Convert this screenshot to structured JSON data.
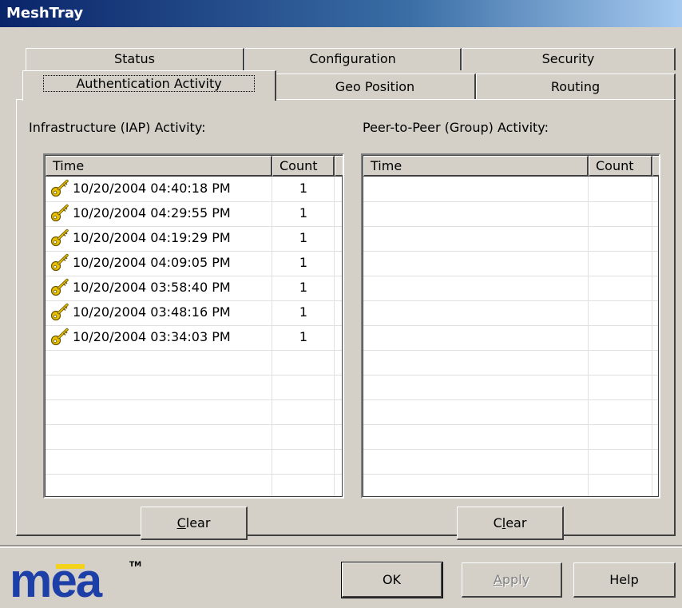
{
  "window": {
    "title": "MeshTray"
  },
  "tabs": {
    "row1": [
      "Status",
      "Configuration",
      "Security"
    ],
    "row2": [
      "Authentication Activity",
      "Geo Position",
      "Routing"
    ]
  },
  "iap": {
    "label": "Infrastructure (IAP) Activity:",
    "columns": [
      "Time",
      "Count"
    ],
    "rows": [
      {
        "time": "10/20/2004 04:40:18 PM",
        "count": "1",
        "icon": "key-icon"
      },
      {
        "time": "10/20/2004 04:29:55 PM",
        "count": "1",
        "icon": "key-icon"
      },
      {
        "time": "10/20/2004 04:19:29 PM",
        "count": "1",
        "icon": "key-icon"
      },
      {
        "time": "10/20/2004 04:09:05 PM",
        "count": "1",
        "icon": "key-icon"
      },
      {
        "time": "10/20/2004 03:58:40 PM",
        "count": "1",
        "icon": "key-icon"
      },
      {
        "time": "10/20/2004 03:48:16 PM",
        "count": "1",
        "icon": "key-icon"
      },
      {
        "time": "10/20/2004 03:34:03 PM",
        "count": "1",
        "icon": "key-icon"
      }
    ],
    "clear": {
      "mnemonic": "C",
      "rest": "lear"
    }
  },
  "p2p": {
    "label": "Peer-to-Peer (Group) Activity:",
    "columns": [
      "Time",
      "Count"
    ],
    "rows": [],
    "clear": {
      "pre": "C",
      "mnemonic": "l",
      "rest": "ear"
    }
  },
  "footer": {
    "logo": "mea",
    "tm": "TM",
    "ok": "OK",
    "apply": {
      "mnemonic": "A",
      "rest": "pply"
    },
    "help": "Help"
  },
  "colors": {
    "titlebar": "#0a246a",
    "logo_blue": "#1c3fa8",
    "logo_yellow": "#f2d21b",
    "key_gold": "#e8c200"
  }
}
